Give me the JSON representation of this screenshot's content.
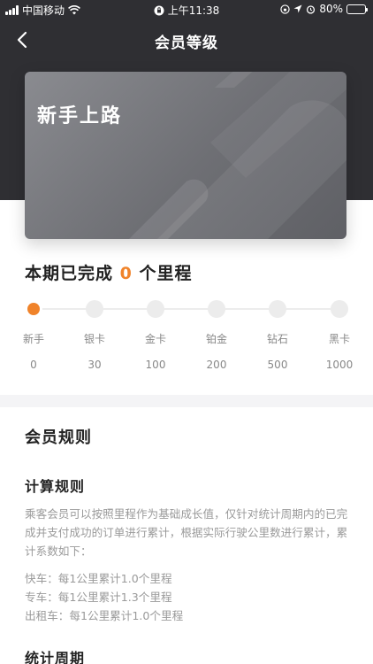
{
  "status_bar": {
    "carrier": "中国移动",
    "time": "上午11:38",
    "battery": "80%"
  },
  "header": {
    "title": "会员等级",
    "back_icon": "chevron-left-icon"
  },
  "card": {
    "level_name": "新手上路"
  },
  "progress": {
    "prefix": "本期已完成",
    "count": "0",
    "suffix": "个里程",
    "accent_color": "#f0832a",
    "levels": [
      {
        "name": "新手",
        "value": "0"
      },
      {
        "name": "银卡",
        "value": "30"
      },
      {
        "name": "金卡",
        "value": "100"
      },
      {
        "name": "铂金",
        "value": "200"
      },
      {
        "name": "钻石",
        "value": "500"
      },
      {
        "name": "黑卡",
        "value": "1000"
      }
    ]
  },
  "rules": {
    "title": "会员规则",
    "calc_title": "计算规则",
    "calc_text": "乘客会员可以按照里程作为基础成长值，仅针对统计周期内的已完成并支付成功的订单进行累计，根据实际行驶公里数进行累计，累计系数如下：",
    "coefficients": [
      "快车：每1公里累计1.0个里程",
      "专车：每1公里累计1.3个里程",
      "出租车：每1公里累计1.0个里程"
    ],
    "period_title": "统计周期"
  }
}
